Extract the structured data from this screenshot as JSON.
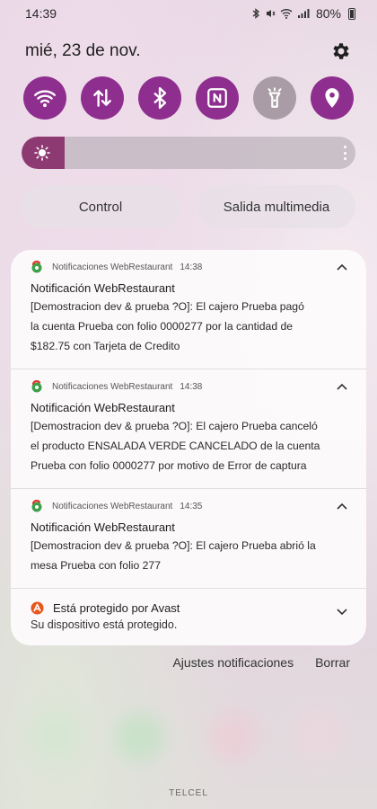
{
  "status_bar": {
    "time": "14:39",
    "battery": "80%"
  },
  "header": {
    "date": "mié, 23 de nov."
  },
  "quick_toggles": [
    {
      "name": "wifi-icon",
      "on": true
    },
    {
      "name": "data-transfer-icon",
      "on": true
    },
    {
      "name": "bluetooth-icon",
      "on": true
    },
    {
      "name": "nfc-icon",
      "on": true
    },
    {
      "name": "flashlight-icon",
      "on": false
    },
    {
      "name": "location-icon",
      "on": true
    }
  ],
  "brightness": {
    "level_percent": 13
  },
  "buttons": {
    "control": "Control",
    "media_output": "Salida multimedia"
  },
  "notifications": [
    {
      "app": "Notificaciones WebRestaurant",
      "time": "14:38",
      "title": "Notificación WebRestaurant",
      "lines": [
        "[Demostracion dev & prueba ?O]: El cajero Prueba pagó",
        "la cuenta  Prueba con folio 0000277 por la cantidad de",
        "$182.75 con Tarjeta de Credito"
      ]
    },
    {
      "app": "Notificaciones WebRestaurant",
      "time": "14:38",
      "title": "Notificación WebRestaurant",
      "lines": [
        "[Demostracion dev & prueba ?O]: El cajero Prueba canceló",
        "el producto ENSALADA VERDE CANCELADO de la cuenta",
        "Prueba con folio 0000277 por motivo de Error de captura"
      ]
    },
    {
      "app": "Notificaciones WebRestaurant",
      "time": "14:35",
      "title": "Notificación WebRestaurant",
      "lines": [
        "[Demostracion dev & prueba ?O]: El cajero Prueba abrió la",
        "mesa Prueba con folio 277"
      ]
    }
  ],
  "avast": {
    "title": "Está protegido por Avast",
    "body": "Su dispositivo está protegido."
  },
  "footer": {
    "settings": "Ajustes notificaciones",
    "clear": "Borrar",
    "carrier": "TELCEL"
  },
  "colors": {
    "toggle_on": "#8e2f8f",
    "toggle_off": "#a99ca6",
    "brightness_fill": "#8e3a72"
  }
}
